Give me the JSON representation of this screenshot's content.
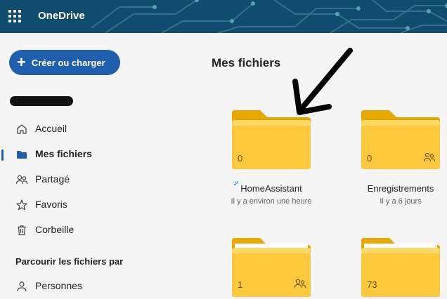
{
  "app": {
    "title": "OneDrive"
  },
  "sidebar": {
    "create_label": "Créer ou charger",
    "items": [
      {
        "label": "Accueil",
        "icon": "home-icon"
      },
      {
        "label": "Mes fichiers",
        "icon": "folder-icon",
        "active": true
      },
      {
        "label": "Partagé",
        "icon": "people-icon"
      },
      {
        "label": "Favoris",
        "icon": "star-icon"
      },
      {
        "label": "Corbeille",
        "icon": "trash-icon"
      }
    ],
    "browse_heading": "Parcourir les fichiers par",
    "browse_items": [
      {
        "label": "Personnes",
        "icon": "person-icon"
      }
    ]
  },
  "main": {
    "title": "Mes fichiers",
    "folders": [
      {
        "name": "HomeAssistant",
        "date": "Il y a environ une heure",
        "count": "0",
        "shared": false,
        "syncing": true
      },
      {
        "name": "Enregistrements",
        "date": "Il y a 6 jours",
        "count": "0",
        "shared": true
      },
      {
        "name": "",
        "date": "",
        "count": "1",
        "shared": true
      },
      {
        "name": "",
        "date": "",
        "count": "73",
        "shared": false
      }
    ]
  },
  "colors": {
    "header": "#0f4c6e",
    "accent": "#1f5fae",
    "folder": "#ffc83d"
  }
}
